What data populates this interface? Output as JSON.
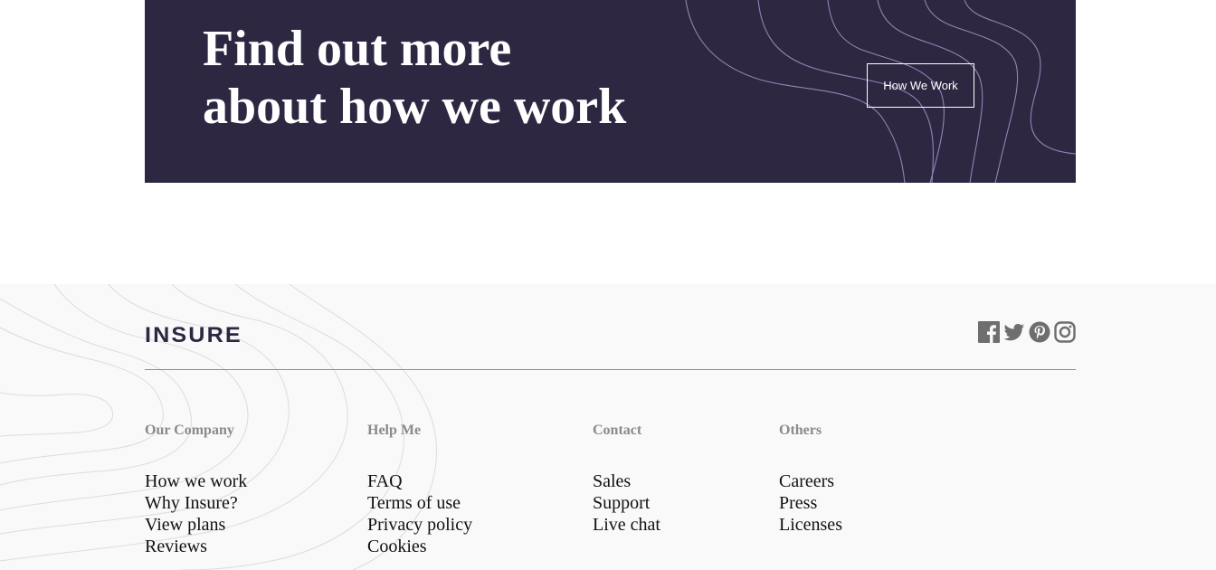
{
  "cta": {
    "title_line1": "Find out more",
    "title_line2": "about how we work",
    "button_label": "How We Work",
    "background": "#2e2742",
    "line_color": "#8e86b3"
  },
  "footer": {
    "logo_text": "INSURE",
    "socials": [
      {
        "name": "facebook-icon"
      },
      {
        "name": "twitter-icon"
      },
      {
        "name": "pinterest-icon"
      },
      {
        "name": "instagram-icon"
      }
    ],
    "columns": [
      {
        "heading": "Our Company",
        "links": [
          "How we work",
          "Why Insure?",
          "View plans",
          "Reviews"
        ]
      },
      {
        "heading": "Help Me",
        "links": [
          "FAQ",
          "Terms of use",
          "Privacy policy",
          "Cookies"
        ]
      },
      {
        "heading": "Contact",
        "links": [
          "Sales",
          "Support",
          "Live chat"
        ]
      },
      {
        "heading": "Others",
        "links": [
          "Careers",
          "Press",
          "Licenses"
        ]
      }
    ]
  }
}
